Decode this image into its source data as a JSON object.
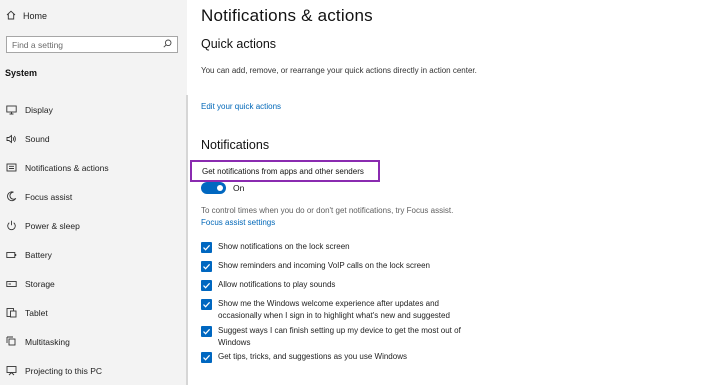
{
  "sidebar": {
    "home_label": "Home",
    "search_placeholder": "Find a setting",
    "category": "System",
    "items": [
      {
        "label": "Display",
        "icon": "display-icon"
      },
      {
        "label": "Sound",
        "icon": "sound-icon"
      },
      {
        "label": "Notifications & actions",
        "icon": "notifications-icon"
      },
      {
        "label": "Focus assist",
        "icon": "focus-assist-icon"
      },
      {
        "label": "Power & sleep",
        "icon": "power-icon"
      },
      {
        "label": "Battery",
        "icon": "battery-icon"
      },
      {
        "label": "Storage",
        "icon": "storage-icon"
      },
      {
        "label": "Tablet",
        "icon": "tablet-icon"
      },
      {
        "label": "Multitasking",
        "icon": "multitasking-icon"
      },
      {
        "label": "Projecting to this PC",
        "icon": "projecting-icon"
      }
    ]
  },
  "main": {
    "title": "Notifications & actions",
    "quick_actions": {
      "heading": "Quick actions",
      "description": "You can add, remove, or rearrange your quick actions directly in action center.",
      "link": "Edit your quick actions"
    },
    "notifications": {
      "heading": "Notifications",
      "toggle_label": "Get notifications from apps and other senders",
      "toggle_state": "On",
      "focus_text": "To control times when you do or don't get notifications, try Focus assist.",
      "focus_link": "Focus assist settings",
      "options": [
        {
          "label": "Show notifications on the lock screen",
          "checked": true
        },
        {
          "label": "Show reminders and incoming VoIP calls on the lock screen",
          "checked": true
        },
        {
          "label": "Allow notifications to play sounds",
          "checked": true
        },
        {
          "label": "Show me the Windows welcome experience after updates and occasionally when I sign in to highlight what's new and suggested",
          "checked": true
        },
        {
          "label": "Suggest ways I can finish setting up my device to get the most out of Windows",
          "checked": true
        },
        {
          "label": "Get tips, tricks, and suggestions as you use Windows",
          "checked": true
        }
      ]
    }
  },
  "colors": {
    "accent": "#0067c0",
    "link": "#0067b8",
    "highlight_border": "#8a2bb0",
    "sidebar_bg": "#f3f3f3"
  }
}
